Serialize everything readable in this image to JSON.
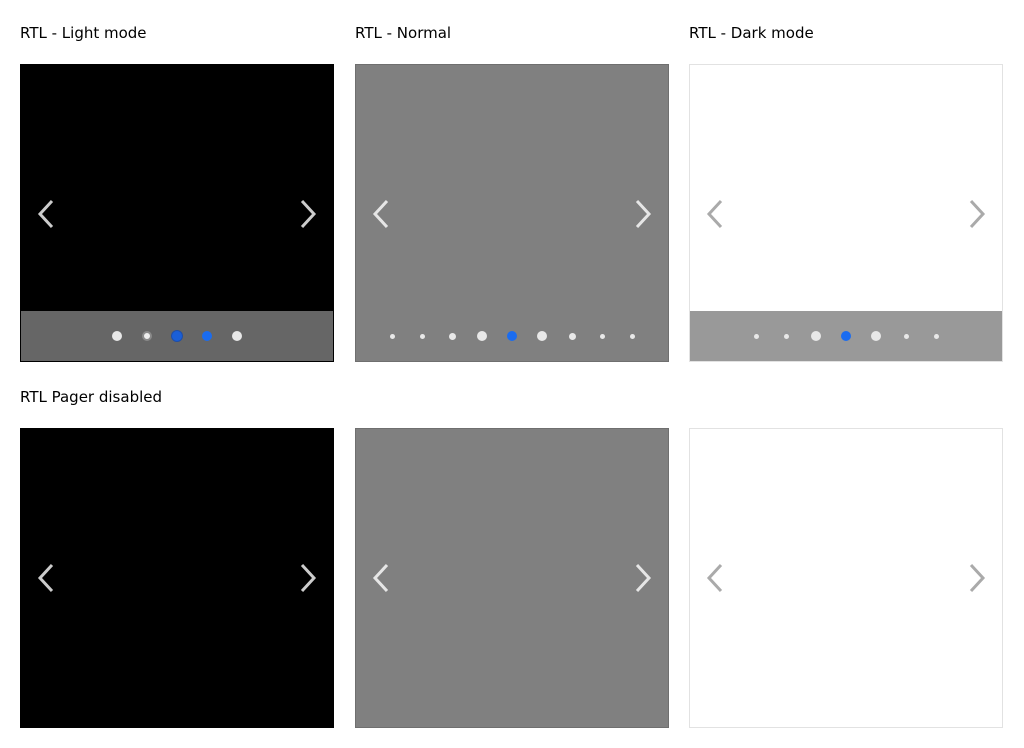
{
  "sections": {
    "rtl_modes": {
      "light_label": "RTL - Light mode",
      "normal_label": "RTL - Normal",
      "dark_label": "RTL - Dark mode"
    },
    "rtl_pager_disabled": {
      "label": "RTL Pager disabled"
    }
  },
  "icons": {
    "prev": "chevron-left-icon",
    "next": "chevron-right-icon"
  },
  "colors": {
    "light_background": "#000000",
    "normal_background": "#808080",
    "dark_background": "#ffffff",
    "active_dot": "#1a6cf0",
    "light_arrow": "#cccccc",
    "dark_arrow": "#aaaaaa"
  },
  "pagers": {
    "light": {
      "dot_count": 5,
      "active_index": 2
    },
    "normal": {
      "dot_count": 9,
      "active_index": 4
    },
    "dark": {
      "dot_count": 7,
      "active_index": 3
    }
  }
}
